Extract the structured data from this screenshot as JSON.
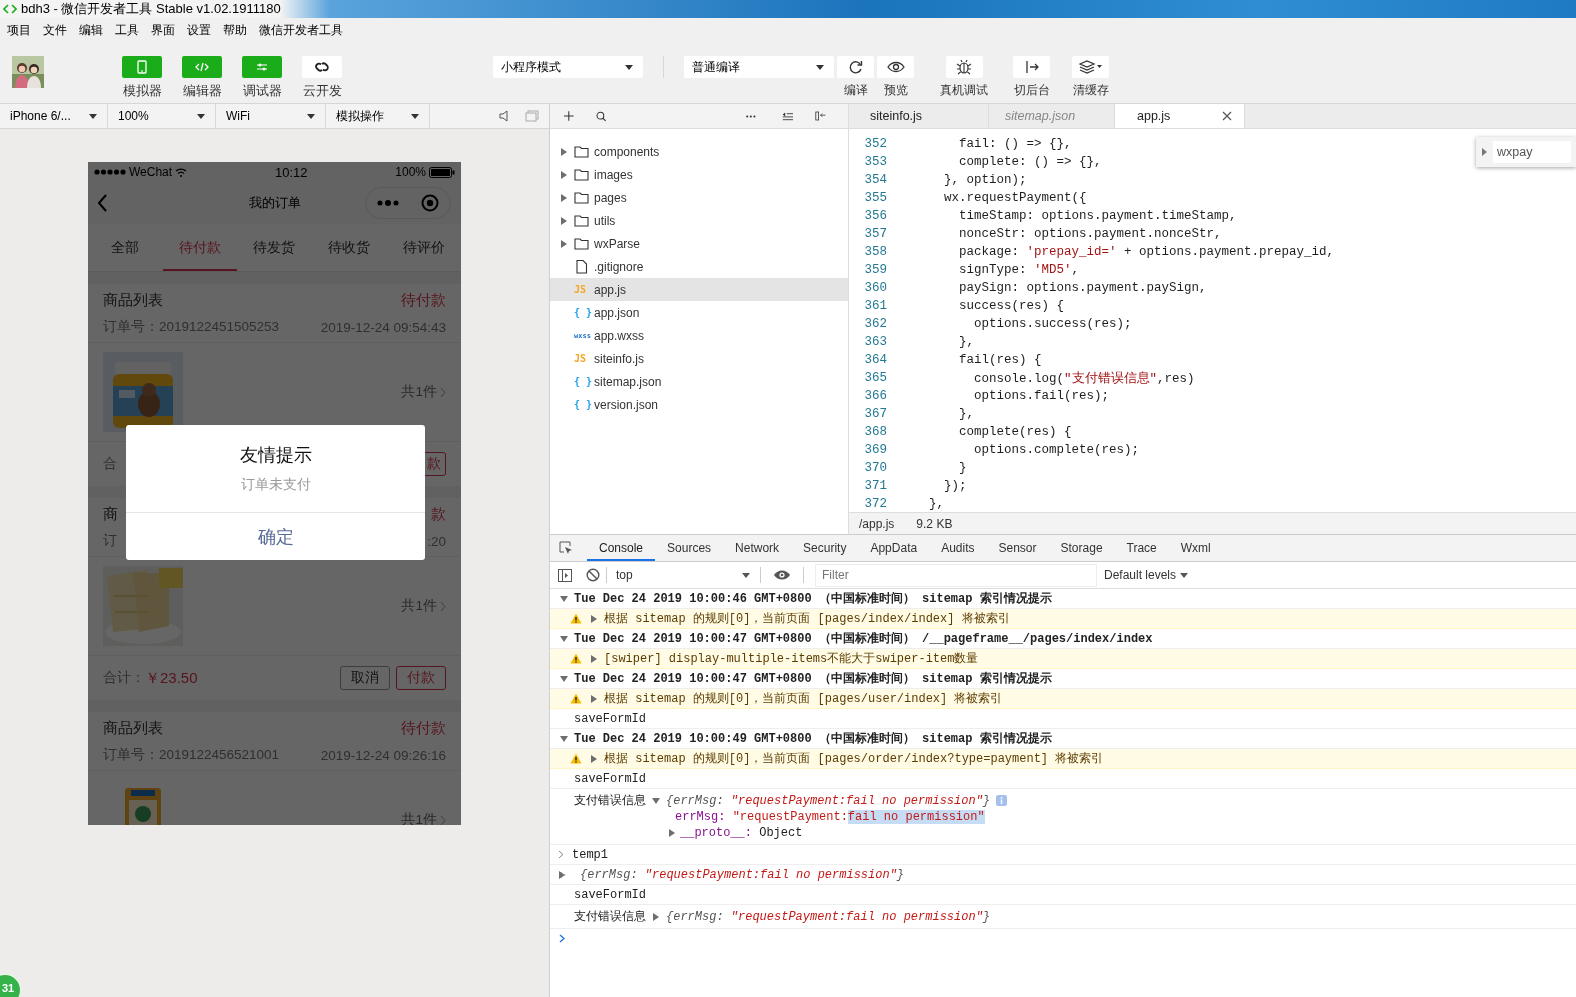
{
  "window": {
    "title": "bdh3 - 微信开发者工具 Stable v1.02.1911180"
  },
  "menu": [
    "项目",
    "文件",
    "编辑",
    "工具",
    "界面",
    "设置",
    "帮助",
    "微信开发者工具"
  ],
  "toolbar": {
    "view_buttons": [
      {
        "label": "模拟器",
        "on": true
      },
      {
        "label": "编辑器",
        "on": true
      },
      {
        "label": "调试器",
        "on": true
      },
      {
        "label": "云开发",
        "on": false
      }
    ],
    "mode": "小程序模式",
    "compile": "普通编译",
    "actions": [
      {
        "label": "编译"
      },
      {
        "label": "预览"
      },
      {
        "label": "真机调试"
      },
      {
        "label": "切后台"
      },
      {
        "label": "清缓存"
      }
    ]
  },
  "simulator": {
    "device": "iPhone 6/...",
    "zoom": "100%",
    "network": "WiFi",
    "operation": "模拟操作",
    "phone": {
      "carrier": "WeChat",
      "time": "10:12",
      "battery": "100%",
      "title": "我的订单",
      "tabs": [
        {
          "label": "全部",
          "selected": false
        },
        {
          "label": "待付款",
          "selected": true
        },
        {
          "label": "待发货",
          "selected": false
        },
        {
          "label": "待收货",
          "selected": false
        },
        {
          "label": "待评价",
          "selected": false
        }
      ],
      "orders": [
        {
          "title": "商品列表",
          "status": "待付款",
          "order_no": "订单号：2019122451505253",
          "date": "2019-12-24 09:54:43",
          "count": "共1件",
          "footer": {
            "total_label": "合",
            "buttons": [
              {
                "label": "款",
                "kind": "primary"
              }
            ]
          }
        },
        {
          "title": "商",
          "status": "款",
          "order_no": "订",
          "date": ":20",
          "count": "共1件",
          "footer": {
            "total_label": "合计：",
            "total": "￥23.50",
            "buttons": [
              {
                "label": "取消",
                "kind": "default"
              },
              {
                "label": "付款",
                "kind": "primary"
              }
            ]
          }
        },
        {
          "title": "商品列表",
          "status": "待付款",
          "order_no": "订单号：2019122456521001",
          "date": "2019-12-24 09:26:16",
          "count": "共1件"
        }
      ],
      "dialog": {
        "title": "友情提示",
        "message": "订单未支付",
        "button": "确定"
      }
    }
  },
  "corner_badge": "31",
  "file_tree": {
    "items": [
      {
        "name": "components",
        "kind": "folder",
        "expanded": false,
        "selected": false
      },
      {
        "name": "images",
        "kind": "folder",
        "expanded": false,
        "selected": false
      },
      {
        "name": "pages",
        "kind": "folder",
        "expanded": false,
        "selected": false
      },
      {
        "name": "utils",
        "kind": "folder",
        "expanded": false,
        "selected": false
      },
      {
        "name": "wxParse",
        "kind": "folder",
        "expanded": false,
        "selected": false
      },
      {
        "name": ".gitignore",
        "kind": "file",
        "selected": false
      },
      {
        "name": "app.js",
        "kind": "js",
        "badge": "JS",
        "selected": true
      },
      {
        "name": "app.json",
        "kind": "json",
        "badge": "{ }",
        "selected": false
      },
      {
        "name": "app.wxss",
        "kind": "wxss",
        "badge": "wxss",
        "selected": false
      },
      {
        "name": "siteinfo.js",
        "kind": "js",
        "badge": "JS",
        "selected": false
      },
      {
        "name": "sitemap.json",
        "kind": "json",
        "badge": "{ }",
        "selected": false
      },
      {
        "name": "version.json",
        "kind": "json",
        "badge": "{ }",
        "selected": false
      }
    ]
  },
  "editor": {
    "tabs": [
      {
        "label": "siteinfo.js",
        "selected": false,
        "preview": false
      },
      {
        "label": "sitemap.json",
        "selected": false,
        "preview": true
      },
      {
        "label": "app.js",
        "selected": true,
        "preview": false,
        "closable": true
      }
    ],
    "lines": [
      {
        "number": "352",
        "segments": [
          {
            "text": "        fail: () => {},",
            "kind": "plain"
          }
        ]
      },
      {
        "number": "353",
        "segments": [
          {
            "text": "        complete: () => {},",
            "kind": "plain"
          }
        ]
      },
      {
        "number": "354",
        "segments": [
          {
            "text": "      }, option);",
            "kind": "plain"
          }
        ]
      },
      {
        "number": "355",
        "segments": [
          {
            "text": "      wx.requestPayment({",
            "kind": "plain"
          }
        ]
      },
      {
        "number": "356",
        "segments": [
          {
            "text": "        timeStamp: options.payment.timeStamp,",
            "kind": "plain"
          }
        ]
      },
      {
        "number": "357",
        "segments": [
          {
            "text": "        nonceStr: options.payment.nonceStr,",
            "kind": "plain"
          }
        ]
      },
      {
        "number": "358",
        "segments": [
          {
            "text": "        package: ",
            "kind": "plain"
          },
          {
            "text": "'prepay_id='",
            "kind": "string"
          },
          {
            "text": " + options.payment.prepay_id,",
            "kind": "plain"
          }
        ]
      },
      {
        "number": "359",
        "segments": [
          {
            "text": "        signType: ",
            "kind": "plain"
          },
          {
            "text": "'MD5'",
            "kind": "string"
          },
          {
            "text": ",",
            "kind": "plain"
          }
        ]
      },
      {
        "number": "360",
        "segments": [
          {
            "text": "        paySign: options.payment.paySign,",
            "kind": "plain"
          }
        ]
      },
      {
        "number": "361",
        "segments": [
          {
            "text": "        success(res) {",
            "kind": "plain"
          }
        ]
      },
      {
        "number": "362",
        "segments": [
          {
            "text": "          options.success(res);",
            "kind": "plain"
          }
        ]
      },
      {
        "number": "363",
        "segments": [
          {
            "text": "        },",
            "kind": "plain"
          }
        ]
      },
      {
        "number": "364",
        "segments": [
          {
            "text": "        fail(res) {",
            "kind": "plain"
          }
        ]
      },
      {
        "number": "365",
        "segments": [
          {
            "text": "          console.log(",
            "kind": "plain"
          },
          {
            "text": "\"支付错误信息\"",
            "kind": "string"
          },
          {
            "text": ",res)",
            "kind": "plain"
          }
        ]
      },
      {
        "number": "366",
        "segments": [
          {
            "text": "          options.fail(res);",
            "kind": "plain"
          }
        ]
      },
      {
        "number": "367",
        "segments": [
          {
            "text": "        },",
            "kind": "plain"
          }
        ]
      },
      {
        "number": "368",
        "segments": [
          {
            "text": "        complete(res) {",
            "kind": "plain"
          }
        ]
      },
      {
        "number": "369",
        "segments": [
          {
            "text": "          options.complete(res);",
            "kind": "plain"
          }
        ]
      },
      {
        "number": "370",
        "segments": [
          {
            "text": "        }",
            "kind": "plain"
          }
        ]
      },
      {
        "number": "371",
        "segments": [
          {
            "text": "      });",
            "kind": "plain"
          }
        ]
      },
      {
        "number": "372",
        "segments": [
          {
            "text": "    },",
            "kind": "plain"
          }
        ]
      }
    ],
    "find": {
      "value": "wxpay"
    },
    "status": {
      "path": "/app.js",
      "size": "9.2 KB"
    }
  },
  "devtools": {
    "tabs": [
      {
        "label": "Console",
        "selected": true
      },
      {
        "label": "Sources",
        "selected": false
      },
      {
        "label": "Network",
        "selected": false
      },
      {
        "label": "Security",
        "selected": false
      },
      {
        "label": "AppData",
        "selected": false
      },
      {
        "label": "Audits",
        "selected": false
      },
      {
        "label": "Sensor",
        "selected": false
      },
      {
        "label": "Storage",
        "selected": false
      },
      {
        "label": "Trace",
        "selected": false
      },
      {
        "label": "Wxml",
        "selected": false
      }
    ],
    "context": "top",
    "filter": {
      "placeholder": "Filter"
    },
    "levels": "Default levels",
    "entries": [
      {
        "kind": "group",
        "expanded": true,
        "text": "Tue Dec 24 2019 10:00:46 GMT+0800 （中国标准时间） sitemap 索引情况提示"
      },
      {
        "kind": "warning",
        "expanded": false,
        "text": "根据 sitemap 的规则[0]，当前页面 [pages/index/index] 将被索引"
      },
      {
        "kind": "group",
        "expanded": true,
        "text": "Tue Dec 24 2019 10:00:47 GMT+0800 （中国标准时间） /__pageframe__/pages/index/index"
      },
      {
        "kind": "warning",
        "expanded": false,
        "text": "[swiper] display-multiple-items不能大于swiper-item数量"
      },
      {
        "kind": "group",
        "expanded": true,
        "text": "Tue Dec 24 2019 10:00:47 GMT+0800 （中国标准时间） sitemap 索引情况提示"
      },
      {
        "kind": "warning",
        "expanded": false,
        "text": "根据 sitemap 的规则[0]，当前页面 [pages/user/index] 将被索引"
      },
      {
        "kind": "log",
        "text": "saveFormId"
      },
      {
        "kind": "group",
        "expanded": true,
        "text": "Tue Dec 24 2019 10:00:49 GMT+0800 （中国标准时间） sitemap 索引情况提示"
      },
      {
        "kind": "warning",
        "expanded": false,
        "text": "根据 sitemap 的规则[0]，当前页面 [pages/order/index?type=payment] 将被索引"
      },
      {
        "kind": "log",
        "text": "saveFormId"
      },
      {
        "kind": "object",
        "label": "支付错误信息",
        "expanded": true,
        "summary": [
          {
            "text": "{errMsg: ",
            "kind": "punct"
          },
          {
            "text": "\"requestPayment:fail no permission\"",
            "kind": "string"
          },
          {
            "text": "}",
            "kind": "punct"
          }
        ],
        "fields": [
          {
            "kind": "string",
            "key": "errMsg:",
            "parts": [
              {
                "text": "\"requestPayment:",
                "selected": false
              },
              {
                "text": "fail no permission\"",
                "selected": true
              }
            ]
          },
          {
            "kind": "prototype",
            "key": "__proto__:",
            "value": "Object",
            "expanded": false
          }
        ]
      },
      {
        "kind": "input",
        "text": "temp1"
      },
      {
        "kind": "result",
        "expanded": false,
        "summary": [
          {
            "text": "{errMsg: ",
            "kind": "punct"
          },
          {
            "text": "\"requestPayment:fail no permission\"",
            "kind": "string"
          },
          {
            "text": "}",
            "kind": "punct"
          }
        ]
      },
      {
        "kind": "log",
        "text": "saveFormId"
      },
      {
        "kind": "object",
        "label": "支付错误信息",
        "expanded": false,
        "summary": [
          {
            "text": "{errMsg: ",
            "kind": "punct"
          },
          {
            "text": "\"requestPayment:fail no permission\"",
            "kind": "string"
          },
          {
            "text": "}",
            "kind": "punct"
          }
        ]
      }
    ]
  }
}
